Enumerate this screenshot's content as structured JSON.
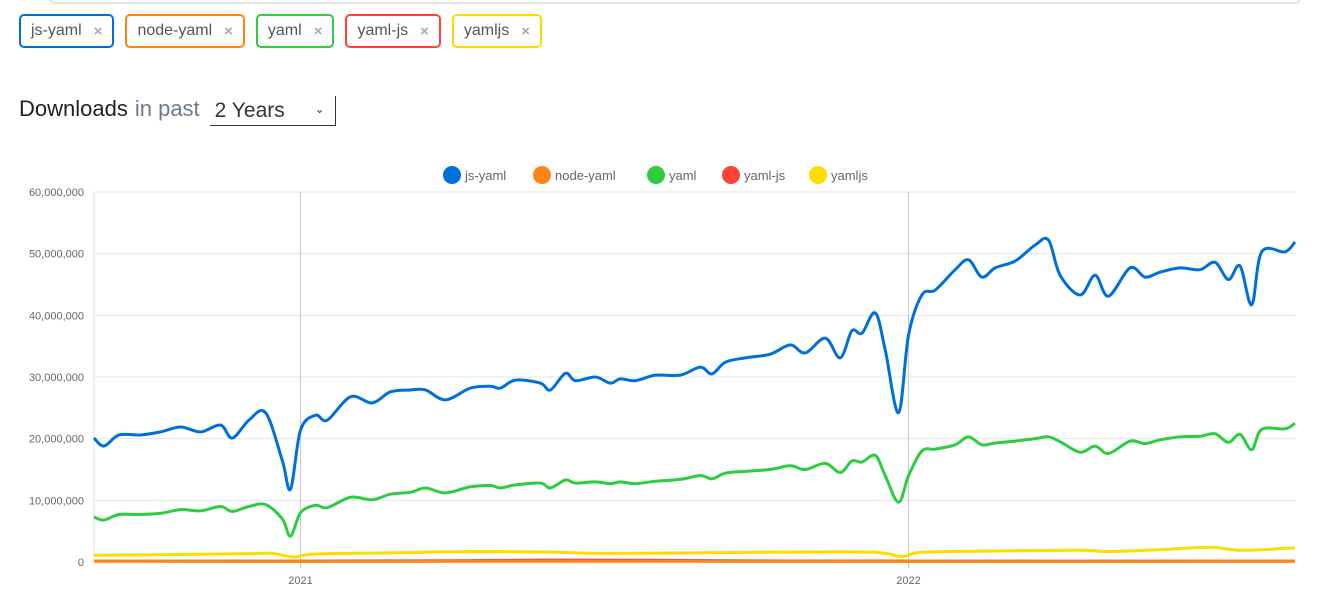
{
  "tags": [
    {
      "label": "js-yaml",
      "color": "#0070d8"
    },
    {
      "label": "node-yaml",
      "color": "#ff8417"
    },
    {
      "label": "yaml",
      "color": "#2ecc40"
    },
    {
      "label": "yaml-js",
      "color": "#ff4136"
    },
    {
      "label": "yamljs",
      "color": "#ffdc00"
    }
  ],
  "remove_icon": "×",
  "heading": {
    "title": "Downloads",
    "in_past": "in past",
    "period": "2 Years",
    "chevron": "⌄"
  },
  "chart_data": {
    "type": "line",
    "title": "",
    "xlabel": "",
    "ylabel": "",
    "ylim": [
      0,
      60000000
    ],
    "xlim": [
      "2020-08-30",
      "2022-08-21"
    ],
    "yticks": [
      "0",
      "10,000,000",
      "20,000,000",
      "30,000,000",
      "40,000,000",
      "50,000,000",
      "60,000,000"
    ],
    "ytick_values": [
      0,
      10000000,
      20000000,
      30000000,
      40000000,
      50000000,
      60000000
    ],
    "xticks": [
      {
        "label": "2021",
        "date": "2021-01-01"
      },
      {
        "label": "2022",
        "date": "2022-01-01"
      }
    ],
    "grid": true,
    "legend": "top",
    "series": [
      {
        "name": "js-yaml",
        "color": "#0070d8",
        "points": [
          [
            "2020-08-30",
            20100000
          ],
          [
            "2020-09-05",
            18800000
          ],
          [
            "2020-09-14",
            20600000
          ],
          [
            "2020-09-27",
            20600000
          ],
          [
            "2020-10-09",
            21100000
          ],
          [
            "2020-10-21",
            21900000
          ],
          [
            "2020-11-02",
            21100000
          ],
          [
            "2020-11-14",
            22200000
          ],
          [
            "2020-11-21",
            20100000
          ],
          [
            "2020-12-01",
            23000000
          ],
          [
            "2020-12-11",
            24200000
          ],
          [
            "2020-12-21",
            16500000
          ],
          [
            "2020-12-26",
            11800000
          ],
          [
            "2021-01-01",
            21400000
          ],
          [
            "2021-01-10",
            23800000
          ],
          [
            "2021-01-17",
            23000000
          ],
          [
            "2021-01-31",
            26800000
          ],
          [
            "2021-02-13",
            25800000
          ],
          [
            "2021-02-24",
            27600000
          ],
          [
            "2021-03-08",
            27900000
          ],
          [
            "2021-03-17",
            27900000
          ],
          [
            "2021-03-29",
            26300000
          ],
          [
            "2021-04-13",
            28200000
          ],
          [
            "2021-04-25",
            28500000
          ],
          [
            "2021-05-01",
            28200000
          ],
          [
            "2021-05-10",
            29500000
          ],
          [
            "2021-05-25",
            29000000
          ],
          [
            "2021-05-31",
            27900000
          ],
          [
            "2021-06-09",
            30600000
          ],
          [
            "2021-06-15",
            29400000
          ],
          [
            "2021-06-27",
            30000000
          ],
          [
            "2021-07-06",
            29000000
          ],
          [
            "2021-07-12",
            29700000
          ],
          [
            "2021-07-21",
            29400000
          ],
          [
            "2021-08-02",
            30300000
          ],
          [
            "2021-08-17",
            30300000
          ],
          [
            "2021-08-29",
            31600000
          ],
          [
            "2021-09-05",
            30500000
          ],
          [
            "2021-09-13",
            32400000
          ],
          [
            "2021-09-25",
            33100000
          ],
          [
            "2021-10-10",
            33700000
          ],
          [
            "2021-10-22",
            35200000
          ],
          [
            "2021-10-31",
            33900000
          ],
          [
            "2021-11-12",
            36300000
          ],
          [
            "2021-11-21",
            33100000
          ],
          [
            "2021-11-28",
            37500000
          ],
          [
            "2021-12-04",
            37100000
          ],
          [
            "2021-12-12",
            40400000
          ],
          [
            "2021-12-18",
            34400000
          ],
          [
            "2021-12-26",
            24200000
          ],
          [
            "2022-01-01",
            36800000
          ],
          [
            "2022-01-09",
            43300000
          ],
          [
            "2022-01-17",
            44100000
          ],
          [
            "2022-01-29",
            47400000
          ],
          [
            "2022-02-06",
            49000000
          ],
          [
            "2022-02-14",
            46200000
          ],
          [
            "2022-02-22",
            47700000
          ],
          [
            "2022-03-06",
            48800000
          ],
          [
            "2022-03-18",
            51400000
          ],
          [
            "2022-03-26",
            52200000
          ],
          [
            "2022-04-02",
            46500000
          ],
          [
            "2022-04-14",
            43300000
          ],
          [
            "2022-04-23",
            46500000
          ],
          [
            "2022-05-01",
            43100000
          ],
          [
            "2022-05-14",
            47700000
          ],
          [
            "2022-05-23",
            46200000
          ],
          [
            "2022-06-01",
            47000000
          ],
          [
            "2022-06-13",
            47700000
          ],
          [
            "2022-06-25",
            47400000
          ],
          [
            "2022-07-04",
            48600000
          ],
          [
            "2022-07-12",
            45800000
          ],
          [
            "2022-07-19",
            48000000
          ],
          [
            "2022-07-26",
            41700000
          ],
          [
            "2022-08-01",
            50300000
          ],
          [
            "2022-08-15",
            50300000
          ],
          [
            "2022-08-21",
            51900000
          ]
        ]
      },
      {
        "name": "node-yaml",
        "color": "#ff8417",
        "points": [
          [
            "2020-08-30",
            150000
          ],
          [
            "2021-01-01",
            100000
          ],
          [
            "2021-06-01",
            120000
          ],
          [
            "2022-01-01",
            100000
          ],
          [
            "2022-08-21",
            120000
          ]
        ]
      },
      {
        "name": "yaml",
        "color": "#2ecc40",
        "points": [
          [
            "2020-08-30",
            7300000
          ],
          [
            "2020-09-05",
            6800000
          ],
          [
            "2020-09-14",
            7700000
          ],
          [
            "2020-09-27",
            7700000
          ],
          [
            "2020-10-09",
            7900000
          ],
          [
            "2020-10-21",
            8500000
          ],
          [
            "2020-11-02",
            8300000
          ],
          [
            "2020-11-14",
            9000000
          ],
          [
            "2020-11-21",
            8200000
          ],
          [
            "2020-12-01",
            9000000
          ],
          [
            "2020-12-11",
            9300000
          ],
          [
            "2020-12-21",
            7000000
          ],
          [
            "2020-12-26",
            4200000
          ],
          [
            "2021-01-01",
            8000000
          ],
          [
            "2021-01-10",
            9200000
          ],
          [
            "2021-01-17",
            8800000
          ],
          [
            "2021-01-31",
            10500000
          ],
          [
            "2021-02-13",
            10100000
          ],
          [
            "2021-02-24",
            11000000
          ],
          [
            "2021-03-08",
            11300000
          ],
          [
            "2021-03-17",
            12000000
          ],
          [
            "2021-03-29",
            11200000
          ],
          [
            "2021-04-13",
            12200000
          ],
          [
            "2021-04-25",
            12400000
          ],
          [
            "2021-05-01",
            12000000
          ],
          [
            "2021-05-10",
            12500000
          ],
          [
            "2021-05-25",
            12800000
          ],
          [
            "2021-05-31",
            12000000
          ],
          [
            "2021-06-09",
            13300000
          ],
          [
            "2021-06-15",
            12800000
          ],
          [
            "2021-06-27",
            13000000
          ],
          [
            "2021-07-06",
            12700000
          ],
          [
            "2021-07-12",
            13000000
          ],
          [
            "2021-07-21",
            12700000
          ],
          [
            "2021-08-02",
            13100000
          ],
          [
            "2021-08-17",
            13400000
          ],
          [
            "2021-08-29",
            14000000
          ],
          [
            "2021-09-05",
            13500000
          ],
          [
            "2021-09-13",
            14400000
          ],
          [
            "2021-09-25",
            14700000
          ],
          [
            "2021-10-10",
            15000000
          ],
          [
            "2021-10-22",
            15600000
          ],
          [
            "2021-10-31",
            15000000
          ],
          [
            "2021-11-12",
            16000000
          ],
          [
            "2021-11-21",
            14500000
          ],
          [
            "2021-11-28",
            16400000
          ],
          [
            "2021-12-04",
            16200000
          ],
          [
            "2021-12-12",
            17300000
          ],
          [
            "2021-12-18",
            14000000
          ],
          [
            "2021-12-26",
            9700000
          ],
          [
            "2022-01-01",
            14000000
          ],
          [
            "2022-01-09",
            18000000
          ],
          [
            "2022-01-17",
            18300000
          ],
          [
            "2022-01-29",
            19000000
          ],
          [
            "2022-02-06",
            20300000
          ],
          [
            "2022-02-14",
            19000000
          ],
          [
            "2022-02-22",
            19300000
          ],
          [
            "2022-03-06",
            19600000
          ],
          [
            "2022-03-18",
            20000000
          ],
          [
            "2022-03-26",
            20300000
          ],
          [
            "2022-04-02",
            19500000
          ],
          [
            "2022-04-14",
            17800000
          ],
          [
            "2022-04-23",
            18800000
          ],
          [
            "2022-05-01",
            17600000
          ],
          [
            "2022-05-14",
            19600000
          ],
          [
            "2022-05-23",
            19200000
          ],
          [
            "2022-06-01",
            19800000
          ],
          [
            "2022-06-13",
            20300000
          ],
          [
            "2022-06-25",
            20400000
          ],
          [
            "2022-07-04",
            20800000
          ],
          [
            "2022-07-12",
            19400000
          ],
          [
            "2022-07-19",
            20700000
          ],
          [
            "2022-07-26",
            18200000
          ],
          [
            "2022-08-01",
            21500000
          ],
          [
            "2022-08-15",
            21600000
          ],
          [
            "2022-08-21",
            22500000
          ]
        ]
      },
      {
        "name": "yaml-js",
        "color": "#ff4136",
        "points": [
          [
            "2020-08-30",
            150000
          ],
          [
            "2021-01-01",
            150000
          ],
          [
            "2021-04-01",
            200000
          ],
          [
            "2021-06-01",
            300000
          ],
          [
            "2021-08-01",
            280000
          ],
          [
            "2021-10-01",
            180000
          ],
          [
            "2022-01-01",
            150000
          ],
          [
            "2022-08-21",
            150000
          ]
        ]
      },
      {
        "name": "yamljs",
        "color": "#ffdc00",
        "points": [
          [
            "2020-08-30",
            1100000
          ],
          [
            "2020-10-15",
            1200000
          ],
          [
            "2020-12-01",
            1350000
          ],
          [
            "2020-12-15",
            1400000
          ],
          [
            "2020-12-28",
            800000
          ],
          [
            "2021-01-10",
            1300000
          ],
          [
            "2021-03-01",
            1500000
          ],
          [
            "2021-04-15",
            1700000
          ],
          [
            "2021-06-01",
            1600000
          ],
          [
            "2021-07-01",
            1400000
          ],
          [
            "2021-09-01",
            1500000
          ],
          [
            "2021-10-15",
            1600000
          ],
          [
            "2021-12-10",
            1600000
          ],
          [
            "2021-12-28",
            900000
          ],
          [
            "2022-01-10",
            1600000
          ],
          [
            "2022-03-01",
            1800000
          ],
          [
            "2022-04-15",
            1900000
          ],
          [
            "2022-05-01",
            1700000
          ],
          [
            "2022-06-01",
            2000000
          ],
          [
            "2022-07-01",
            2400000
          ],
          [
            "2022-07-20",
            1900000
          ],
          [
            "2022-08-21",
            2300000
          ]
        ]
      }
    ]
  }
}
